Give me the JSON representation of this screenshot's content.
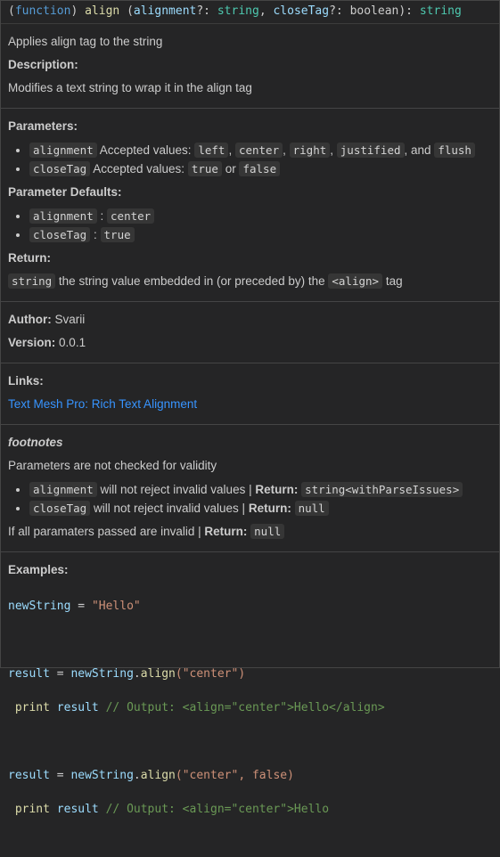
{
  "signature": {
    "open": "(",
    "kind": "function",
    "close": ")",
    "name": "align",
    "paren_open": "(",
    "p1": "alignment",
    "p1_suffix": "?: ",
    "p1_type": "string",
    "sep": ", ",
    "p2": "closeTag",
    "p2_suffix": "?: boolean): ",
    "return_type": "string"
  },
  "summary": "Applies align tag to the string",
  "description": {
    "heading": "Description:",
    "text": "Modifies a text string to wrap it in the align tag"
  },
  "parameters": {
    "heading": "Parameters:",
    "items": [
      {
        "name": "alignment",
        "label": "Accepted values:",
        "values": [
          "left",
          "center",
          "right",
          "justified",
          "flush"
        ],
        "joiner": ", and"
      },
      {
        "name": "closeTag",
        "label": "Accepted values:",
        "values": [
          "true",
          "false"
        ],
        "joiner": "or"
      }
    ]
  },
  "defaults": {
    "heading": "Parameter Defaults:",
    "items": [
      {
        "name": "alignment",
        "sep": ":",
        "value": "center"
      },
      {
        "name": "closeTag",
        "sep": ":",
        "value": "true"
      }
    ]
  },
  "return": {
    "heading": "Return:",
    "type": "string",
    "text": "the string value embedded in (or preceded by) the",
    "tag": "<align>",
    "suffix": "tag"
  },
  "author": {
    "label": "Author:",
    "value": "Svarii"
  },
  "version": {
    "label": "Version:",
    "value": "0.0.1"
  },
  "links": {
    "heading": "Links:",
    "link_text": "Text Mesh Pro: Rich Text Alignment"
  },
  "footnotes": {
    "heading": "footnotes",
    "intro": "Parameters are not checked for validity",
    "items": [
      {
        "name": "alignment",
        "text": "will not reject invalid values |",
        "ret_label": "Return:",
        "ret_value": "string<withParseIssues>"
      },
      {
        "name": "closeTag",
        "text": "will not reject invalid values |",
        "ret_label": "Return:",
        "ret_value": "null"
      }
    ],
    "all_text": "If all paramaters passed are invalid |",
    "all_ret_label": "Return:",
    "all_ret_value": "null"
  },
  "examples": {
    "heading": "Examples:",
    "lines": {
      "l1_var": "newString",
      "l1_eq": " = ",
      "l1_str": "\"Hello\"",
      "l2_var": "result",
      "l2_eq": " = ",
      "l2_obj": "newString",
      "l2_dot": ".",
      "l2_method": "align",
      "l2_args": "(\"center\")",
      "l3_kw": " print",
      "l3_var": " result",
      "l3_comment": " // Output: <align=\"center\">Hello</align>",
      "l4_var": "result",
      "l4_eq": " = ",
      "l4_obj": "newString",
      "l4_dot": ".",
      "l4_method": "align",
      "l4_args": "(\"center\", false)",
      "l5_kw": " print",
      "l5_var": " result",
      "l5_comment": " // Output: <align=\"center\">Hello"
    }
  }
}
